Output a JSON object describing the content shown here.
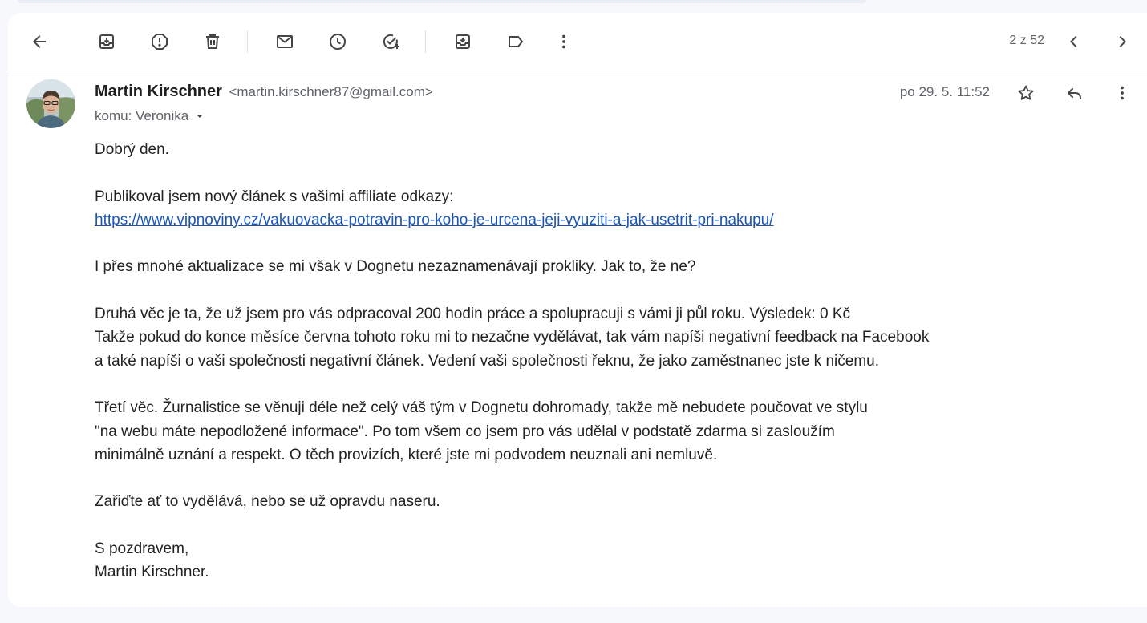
{
  "toolbar": {
    "icons": [
      "back-arrow-icon",
      "archive-icon",
      "report-spam-icon",
      "delete-icon",
      "mark-unread-icon",
      "snooze-icon",
      "add-task-icon",
      "move-to-icon",
      "label-icon",
      "more-vert-icon"
    ],
    "pager": "2 z 52"
  },
  "message": {
    "sender_name": "Martin Kirschner",
    "sender_email": "<martin.kirschner87@gmail.com>",
    "recipient": "komu: Veronika",
    "date": "po 29. 5. 11:52"
  },
  "body": {
    "greeting": "Dobrý den.",
    "p1_line1": "Publikoval jsem nový článek s vašimi affiliate odkazy:",
    "link": "https://www.vipnoviny.cz/vakuovacka-potravin-pro-koho-je-urcena-jeji-vyuziti-a-jak-usetrit-pri-nakupu/",
    "p2": "I přes mnohé aktualizace se mi však v Dognetu nezaznamenávají prokliky. Jak to, že ne?",
    "p3_line1": "Druhá věc je ta, že už jsem pro vás odpracoval 200 hodin práce a spolupracuji s vámi ji půl roku. Výsledek: 0 Kč",
    "p3_line2": "Takže pokud do konce měsíce června tohoto roku mi to nezačne vydělávat, tak vám napíši negativní feedback na Facebook",
    "p3_line3": "a také napíši o vaši společnosti negativní článek. Vedení vaši společnosti řeknu, že jako zaměstnanec jste k ničemu.",
    "p4_line1": "Třetí věc. Žurnalistice se věnuji déle než celý váš tým v Dognetu dohromady, takže mě nebudete poučovat ve stylu",
    "p4_line2": "\"na webu máte nepodložené informace\". Po tom všem co jsem pro vás udělal v podstatě zdarma si zasloužím",
    "p4_line3": "minimálně uznání a respekt. O těch provizích, které jste mi podvodem neuznali ani nemluvě.",
    "p5": "Zařiďte ať to vydělává, nebo se už opravdu naseru.",
    "sign1": "S pozdravem,",
    "sign2": "Martin Kirschner."
  }
}
